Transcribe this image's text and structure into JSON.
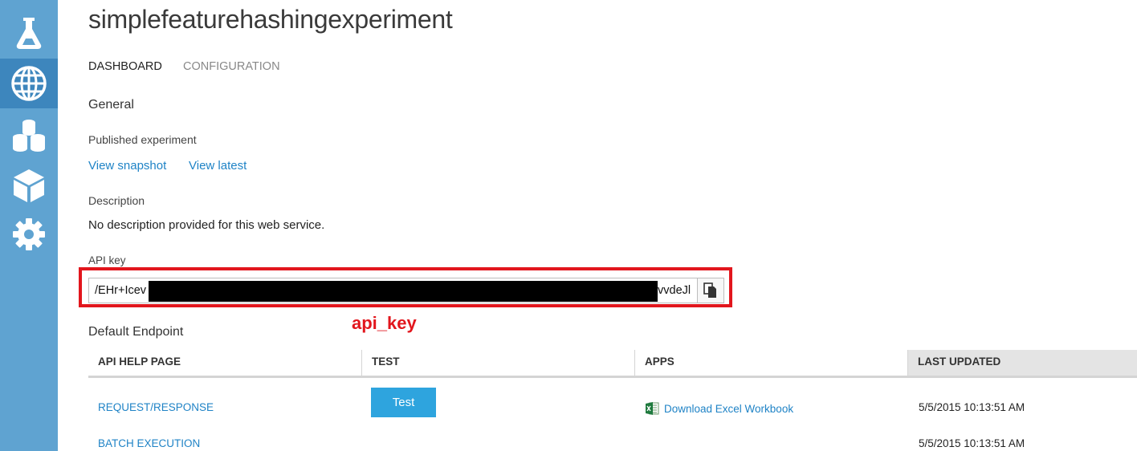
{
  "nav": {
    "items": [
      {
        "icon": "flask-icon"
      },
      {
        "icon": "globe-icon",
        "active": true
      },
      {
        "icon": "datasets-icon"
      },
      {
        "icon": "cube-icon"
      },
      {
        "icon": "gear-icon"
      }
    ],
    "accent_color": "#5fa3d1",
    "active_color": "#3d86bd"
  },
  "page": {
    "title": "simplefeaturehashingexperiment",
    "tabs": [
      {
        "label": "DASHBOARD",
        "active": true
      },
      {
        "label": "CONFIGURATION",
        "active": false
      }
    ]
  },
  "general": {
    "heading": "General",
    "published_label": "Published experiment",
    "view_snapshot": "View snapshot",
    "view_latest": "View latest",
    "description_label": "Description",
    "description_text": "No description provided for this web service.",
    "api_key_label": "API key",
    "api_key_prefix": "/EHr+Icev",
    "api_key_suffix": "vvdeJl",
    "annotation": "api_key",
    "highlight_color": "#e2161d"
  },
  "endpoint": {
    "heading": "Default Endpoint",
    "columns": [
      "API HELP PAGE",
      "TEST",
      "APPS",
      "LAST UPDATED"
    ],
    "rows": [
      {
        "help": "REQUEST/RESPONSE",
        "test": "Test",
        "apps": "Download Excel Workbook",
        "updated": "5/5/2015 10:13:51 AM"
      },
      {
        "help": "BATCH EXECUTION",
        "updated": "5/5/2015 10:13:51 AM"
      }
    ],
    "link_color": "#1f83c6",
    "button_color": "#2ea4de"
  }
}
